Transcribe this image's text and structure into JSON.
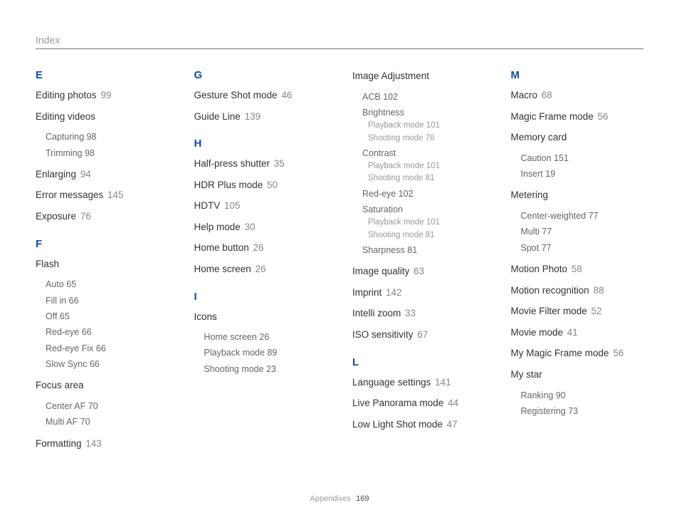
{
  "header": {
    "title": "Index"
  },
  "footer": {
    "section": "Appendixes",
    "page": "169"
  },
  "columns": [
    {
      "sections": [
        {
          "letter": "E",
          "items": [
            {
              "label": "Editing photos",
              "page": "99"
            },
            {
              "label": "Editing videos",
              "subs": [
                {
                  "label": "Capturing",
                  "page": "98"
                },
                {
                  "label": "Trimming",
                  "page": "98"
                }
              ]
            },
            {
              "label": "Enlarging",
              "page": "94"
            },
            {
              "label": "Error messages",
              "page": "145"
            },
            {
              "label": "Exposure",
              "page": "76"
            }
          ]
        },
        {
          "letter": "F",
          "items": [
            {
              "label": "Flash",
              "subs": [
                {
                  "label": "Auto",
                  "page": "65"
                },
                {
                  "label": "Fill in",
                  "page": "66"
                },
                {
                  "label": "Off",
                  "page": "65"
                },
                {
                  "label": "Red-eye",
                  "page": "66"
                },
                {
                  "label": "Red-eye Fix",
                  "page": "66"
                },
                {
                  "label": "Slow Sync",
                  "page": "66"
                }
              ]
            },
            {
              "label": "Focus area",
              "subs": [
                {
                  "label": "Center AF",
                  "page": "70"
                },
                {
                  "label": "Multi AF",
                  "page": "70"
                }
              ]
            },
            {
              "label": "Formatting",
              "page": "143"
            }
          ]
        }
      ]
    },
    {
      "sections": [
        {
          "letter": "G",
          "items": [
            {
              "label": "Gesture Shot mode",
              "page": "46"
            },
            {
              "label": "Guide Line",
              "page": "139"
            }
          ]
        },
        {
          "letter": "H",
          "items": [
            {
              "label": "Half-press shutter",
              "page": "35"
            },
            {
              "label": "HDR Plus mode",
              "page": "50"
            },
            {
              "label": "HDTV",
              "page": "105"
            },
            {
              "label": "Help mode",
              "page": "30"
            },
            {
              "label": "Home button",
              "page": "26"
            },
            {
              "label": "Home screen",
              "page": "26"
            }
          ]
        },
        {
          "letter": "I",
          "items": [
            {
              "label": "Icons",
              "subs": [
                {
                  "label": "Home screen",
                  "page": "26"
                },
                {
                  "label": "Playback mode",
                  "page": "89"
                },
                {
                  "label": "Shooting mode",
                  "page": "23"
                }
              ]
            }
          ]
        }
      ]
    },
    {
      "sections": [
        {
          "letter": "",
          "items": [
            {
              "label": "Image Adjustment",
              "subs": [
                {
                  "label": "ACB",
                  "page": "102"
                },
                {
                  "label": "Brightness",
                  "subsubs": [
                    {
                      "label": "Playback mode",
                      "page": "101"
                    },
                    {
                      "label": "Shooting mode",
                      "page": "76"
                    }
                  ]
                },
                {
                  "label": "Contrast",
                  "subsubs": [
                    {
                      "label": "Playback mode",
                      "page": "101"
                    },
                    {
                      "label": "Shooting mode",
                      "page": "81"
                    }
                  ]
                },
                {
                  "label": "Red-eye",
                  "page": "102"
                },
                {
                  "label": "Saturation",
                  "subsubs": [
                    {
                      "label": "Playback mode",
                      "page": "101"
                    },
                    {
                      "label": "Shooting mode",
                      "page": "81"
                    }
                  ]
                },
                {
                  "label": "Sharpness",
                  "page": "81"
                }
              ]
            },
            {
              "label": "Image quality",
              "page": "63"
            },
            {
              "label": "Imprint",
              "page": "142"
            },
            {
              "label": "Intelli zoom",
              "page": "33"
            },
            {
              "label": "ISO sensitivity",
              "page": "67"
            }
          ]
        },
        {
          "letter": "L",
          "items": [
            {
              "label": "Language settings",
              "page": "141"
            },
            {
              "label": "Live Panorama mode",
              "page": "44"
            },
            {
              "label": "Low Light Shot mode",
              "page": "47"
            }
          ]
        }
      ]
    },
    {
      "sections": [
        {
          "letter": "M",
          "items": [
            {
              "label": "Macro",
              "page": "68"
            },
            {
              "label": "Magic Frame mode",
              "page": "56"
            },
            {
              "label": "Memory card",
              "subs": [
                {
                  "label": "Caution",
                  "page": "151"
                },
                {
                  "label": "Insert",
                  "page": "19"
                }
              ]
            },
            {
              "label": "Metering",
              "subs": [
                {
                  "label": "Center-weighted",
                  "page": "77"
                },
                {
                  "label": "Multi",
                  "page": "77"
                },
                {
                  "label": "Spot",
                  "page": "77"
                }
              ]
            },
            {
              "label": "Motion Photo",
              "page": "58"
            },
            {
              "label": "Motion recognition",
              "page": "88"
            },
            {
              "label": "Movie Filter mode",
              "page": "52"
            },
            {
              "label": "Movie mode",
              "page": "41"
            },
            {
              "label": "My Magic Frame mode",
              "page": "56"
            },
            {
              "label": "My star",
              "subs": [
                {
                  "label": "Ranking",
                  "page": "90"
                },
                {
                  "label": "Registering",
                  "page": "73"
                }
              ]
            }
          ]
        }
      ]
    }
  ]
}
